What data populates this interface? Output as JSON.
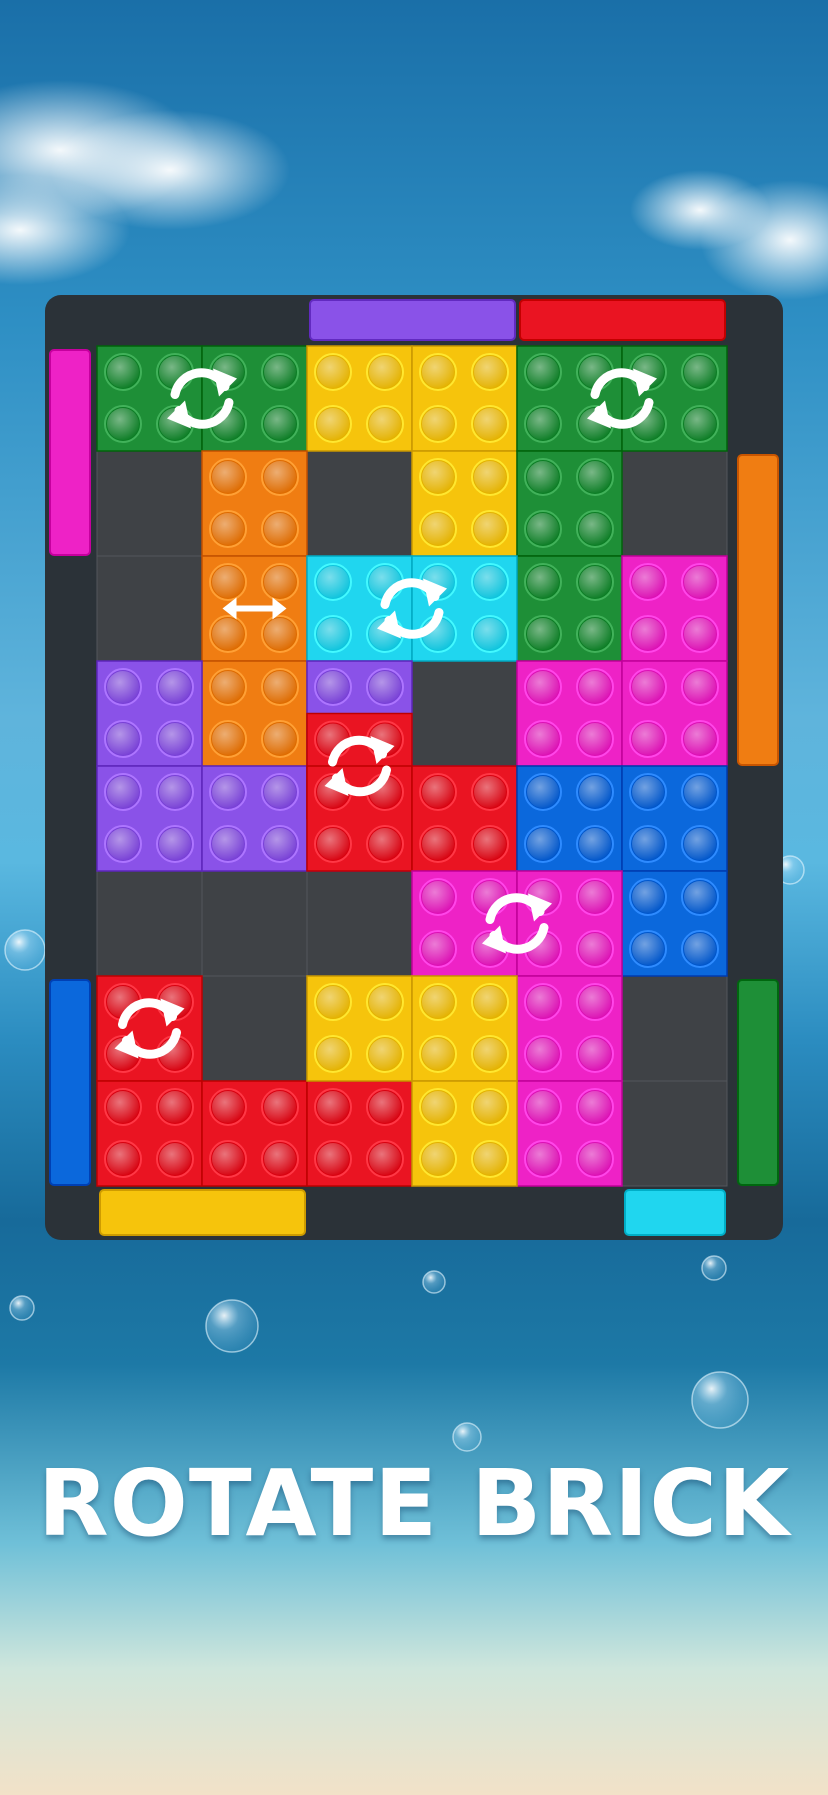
{
  "caption": "ROTATE BRICK",
  "colors": {
    "board_frame": "#2b3238",
    "empty_cell": "#3f4246",
    "rotate_icon": "#ffffff",
    "green": "#1e8f37",
    "yellow": "#f6c40c",
    "orange": "#f07d12",
    "cyan": "#20d6ef",
    "magenta": "#ee22c6",
    "purple": "#8a52e8",
    "red": "#ea1422",
    "blue": "#0b68dc"
  },
  "grid": {
    "columns": 6,
    "rows": 8
  },
  "exit_gates": [
    {
      "side": "top",
      "color": "purple"
    },
    {
      "side": "top",
      "color": "red"
    },
    {
      "side": "left",
      "color": "magenta"
    },
    {
      "side": "left",
      "color": "blue"
    },
    {
      "side": "right",
      "color": "orange"
    },
    {
      "side": "right",
      "color": "green"
    },
    {
      "side": "bottom",
      "color": "yellow"
    },
    {
      "side": "bottom",
      "color": "cyan"
    }
  ],
  "bricks": [
    {
      "id": "green-top-left",
      "color": "green",
      "cells": [
        [
          0,
          0
        ],
        [
          1,
          0
        ]
      ],
      "control": "rotate-icon"
    },
    {
      "id": "yellow-top",
      "color": "yellow",
      "cells": [
        [
          2,
          0
        ],
        [
          3,
          0
        ],
        [
          3,
          1
        ]
      ],
      "control": "none"
    },
    {
      "id": "green-top-right",
      "color": "green",
      "cells": [
        [
          4,
          0
        ],
        [
          5,
          0
        ],
        [
          4,
          1
        ],
        [
          4,
          2
        ]
      ],
      "control": "rotate-icon"
    },
    {
      "id": "orange",
      "color": "orange",
      "cells": [
        [
          1,
          1
        ],
        [
          1,
          2
        ],
        [
          1,
          3
        ]
      ],
      "control": "move-horizontal-icon"
    },
    {
      "id": "cyan",
      "color": "cyan",
      "cells": [
        [
          2,
          2
        ],
        [
          3,
          2
        ]
      ],
      "control": "rotate-icon"
    },
    {
      "id": "magenta-upper",
      "color": "magenta",
      "cells": [
        [
          5,
          2
        ],
        [
          4,
          3
        ],
        [
          5,
          3
        ]
      ],
      "control": "none"
    },
    {
      "id": "purple",
      "color": "purple",
      "cells": [
        [
          0,
          3
        ],
        [
          0,
          4
        ],
        [
          1,
          4
        ],
        [
          2,
          3
        ],
        [
          2,
          4
        ],
        [
          3,
          4
        ]
      ],
      "control": "none"
    },
    {
      "id": "red-middle",
      "color": "red",
      "cells": [
        [
          2,
          3.5
        ],
        [
          2,
          4
        ],
        [
          3,
          4
        ]
      ],
      "control": "rotate-icon"
    },
    {
      "id": "blue",
      "color": "blue",
      "cells": [
        [
          4,
          4
        ],
        [
          5,
          4
        ],
        [
          5,
          5
        ]
      ],
      "control": "none"
    },
    {
      "id": "magenta-lower",
      "color": "magenta",
      "cells": [
        [
          3,
          5
        ],
        [
          4,
          5
        ],
        [
          4,
          6
        ],
        [
          4,
          7
        ]
      ],
      "control": "rotate-icon"
    },
    {
      "id": "red-bottom",
      "color": "red",
      "cells": [
        [
          0,
          6
        ],
        [
          0,
          7
        ],
        [
          1,
          7
        ],
        [
          2,
          7
        ]
      ],
      "control": "rotate-icon"
    },
    {
      "id": "yellow-bottom",
      "color": "yellow",
      "cells": [
        [
          2,
          6
        ],
        [
          3,
          6
        ],
        [
          3,
          7
        ]
      ],
      "control": "none"
    }
  ]
}
